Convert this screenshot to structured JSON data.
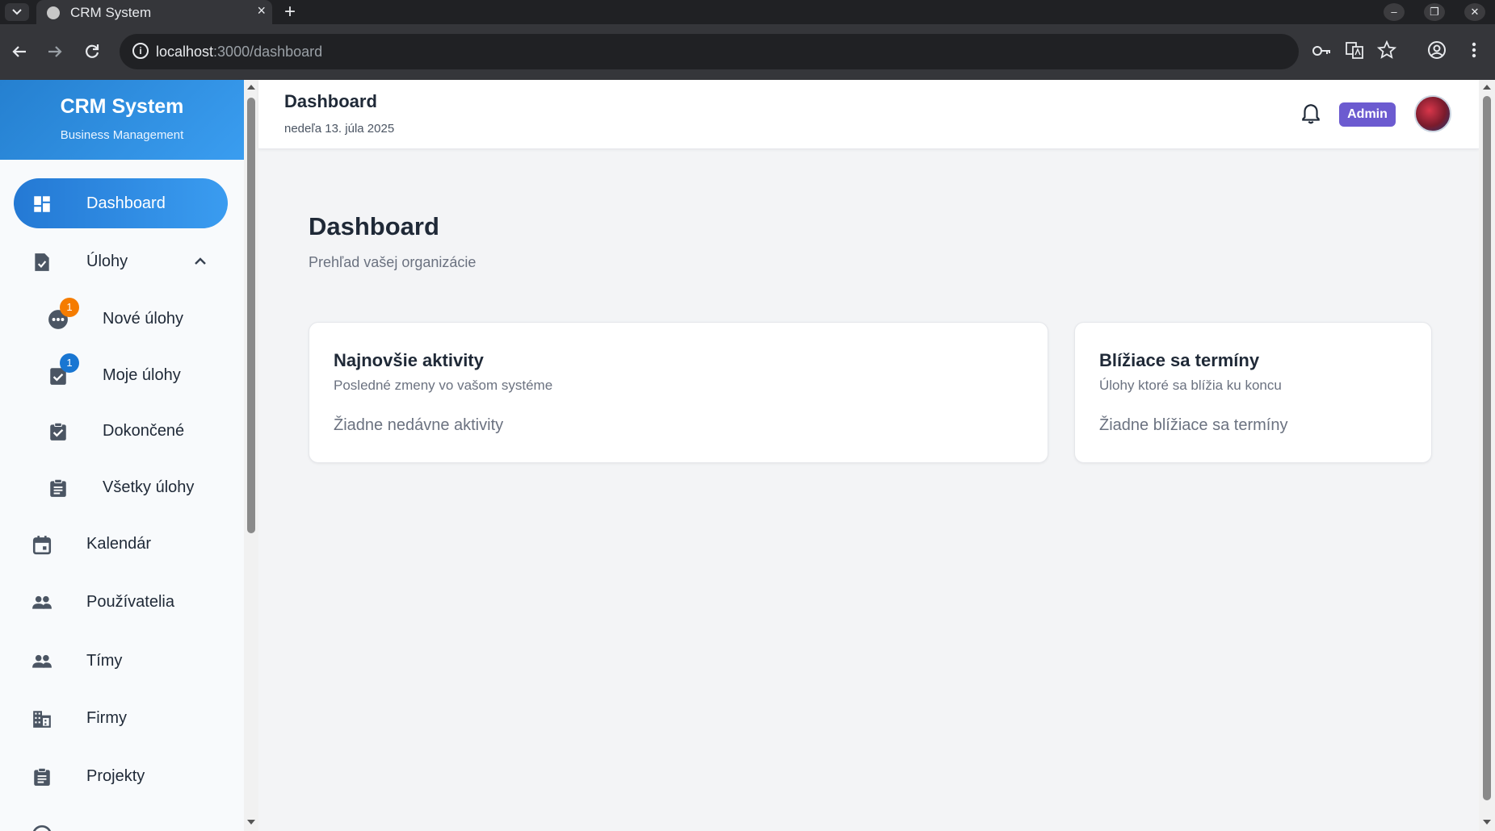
{
  "browser": {
    "tab_title": "CRM System",
    "tab_close": "×",
    "new_tab": "+",
    "url_host": "localhost",
    "url_path": ":3000/dashboard",
    "win_minimize": "–",
    "win_restore": "❐",
    "win_close": "✕"
  },
  "sidebar": {
    "brand_title": "CRM System",
    "brand_subtitle": "Business Management",
    "items": {
      "dashboard": "Dashboard",
      "ulohy": "Úlohy",
      "nove_ulohy": "Nové úlohy",
      "moje_ulohy": "Moje úlohy",
      "dokoncene": "Dokončené",
      "vsetky_ulohy": "Všetky úlohy",
      "kalendar": "Kalendár",
      "pouzivatelia": "Používatelia",
      "timy": "Tímy",
      "firmy": "Firmy",
      "projekty": "Projekty"
    },
    "badges": {
      "nove_ulohy": "1",
      "moje_ulohy": "1"
    }
  },
  "header": {
    "title": "Dashboard",
    "date": "nedeľa 13. júla 2025",
    "role_badge": "Admin"
  },
  "page": {
    "title": "Dashboard",
    "subtitle": "Prehľad vašej organizácie"
  },
  "cards": {
    "activities": {
      "title": "Najnovšie aktivity",
      "subtitle": "Posledné zmeny vo vašom systéme",
      "empty": "Žiadne nedávne aktivity"
    },
    "deadlines": {
      "title": "Blížiace sa termíny",
      "subtitle": "Úlohy ktoré sa blížia ku koncu",
      "empty": "Žiadne blížiace sa termíny"
    }
  },
  "colors": {
    "primary": "#2479d4",
    "admin_badge": "#6c5bd0",
    "badge_orange": "#f57c00",
    "badge_blue": "#1976d2"
  }
}
